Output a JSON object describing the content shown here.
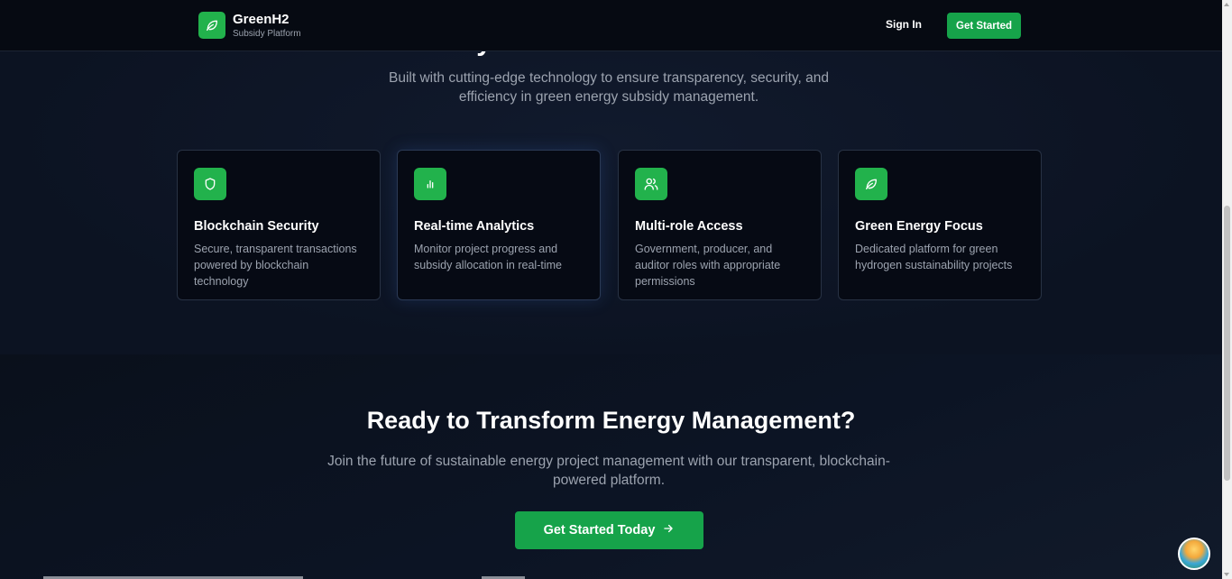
{
  "nav": {
    "brand_name": "GreenH2",
    "brand_sub": "Subsidy Platform",
    "sign_in": "Sign In",
    "get_started": "Get Started"
  },
  "features": {
    "heading_partial": "Why Choose Our Platform?",
    "subtitle": "Built with cutting-edge technology to ensure transparency, security, and efficiency in green energy subsidy management.",
    "cards": [
      {
        "title": "Blockchain Security",
        "desc": "Secure, transparent transactions powered by blockchain technology",
        "icon": "shield-icon"
      },
      {
        "title": "Real-time Analytics",
        "desc": "Monitor project progress and subsidy allocation in real-time",
        "icon": "bar-chart-icon"
      },
      {
        "title": "Multi-role Access",
        "desc": "Government, producer, and auditor roles with appropriate permissions",
        "icon": "users-icon"
      },
      {
        "title": "Green Energy Focus",
        "desc": "Dedicated platform for green hydrogen sustainability projects",
        "icon": "leaf-icon"
      }
    ]
  },
  "cta": {
    "title": "Ready to Transform Energy Management?",
    "subtitle": "Join the future of sustainable energy project management with our transparent, blockchain-powered platform.",
    "button": "Get Started Today"
  },
  "colors": {
    "accent": "#16a34a",
    "background": "#0b1220",
    "card_bg": "#060a14"
  }
}
